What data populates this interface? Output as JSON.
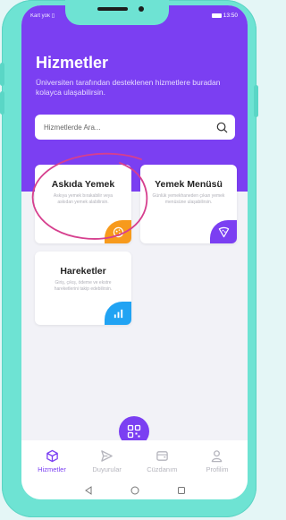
{
  "status": {
    "carrier": "Kart yok",
    "time": "13:50"
  },
  "header": {
    "title": "Hizmetler",
    "subtitle": "Üniversiten tarafından desteklenen hizmetlere buradan kolayca ulaşabilirsin."
  },
  "search": {
    "placeholder": "Hizmetlerde Ara..."
  },
  "cards": [
    {
      "title": "Askıda Yemek",
      "desc": "Askıya yemek bırakabilir veya askıdan yemek alabilirsin.",
      "icon": "cookie-icon",
      "color": "#f79a1c"
    },
    {
      "title": "Yemek Menüsü",
      "desc": "Günlük yemekhaneden çıkan yemek menüsüne ulaşabilirsin.",
      "icon": "pizza-icon",
      "color": "#7b3ff2"
    },
    {
      "title": "Hareketler",
      "desc": "Giriş, çıkış, ödeme ve ekstre hareketlerini takip edebilirsin.",
      "icon": "bar-chart-icon",
      "color": "#21a3f3"
    }
  ],
  "nav": [
    {
      "label": "Hizmetler",
      "icon": "cube-icon",
      "active": true
    },
    {
      "label": "Duyurular",
      "icon": "send-icon",
      "active": false
    },
    {
      "label": "Cüzdanım",
      "icon": "wallet-icon",
      "active": false
    },
    {
      "label": "Profilim",
      "icon": "user-icon",
      "active": false
    }
  ],
  "colors": {
    "primary": "#7b3ff2",
    "frame": "#6ee3d3",
    "annotation": "#d63f8e"
  }
}
